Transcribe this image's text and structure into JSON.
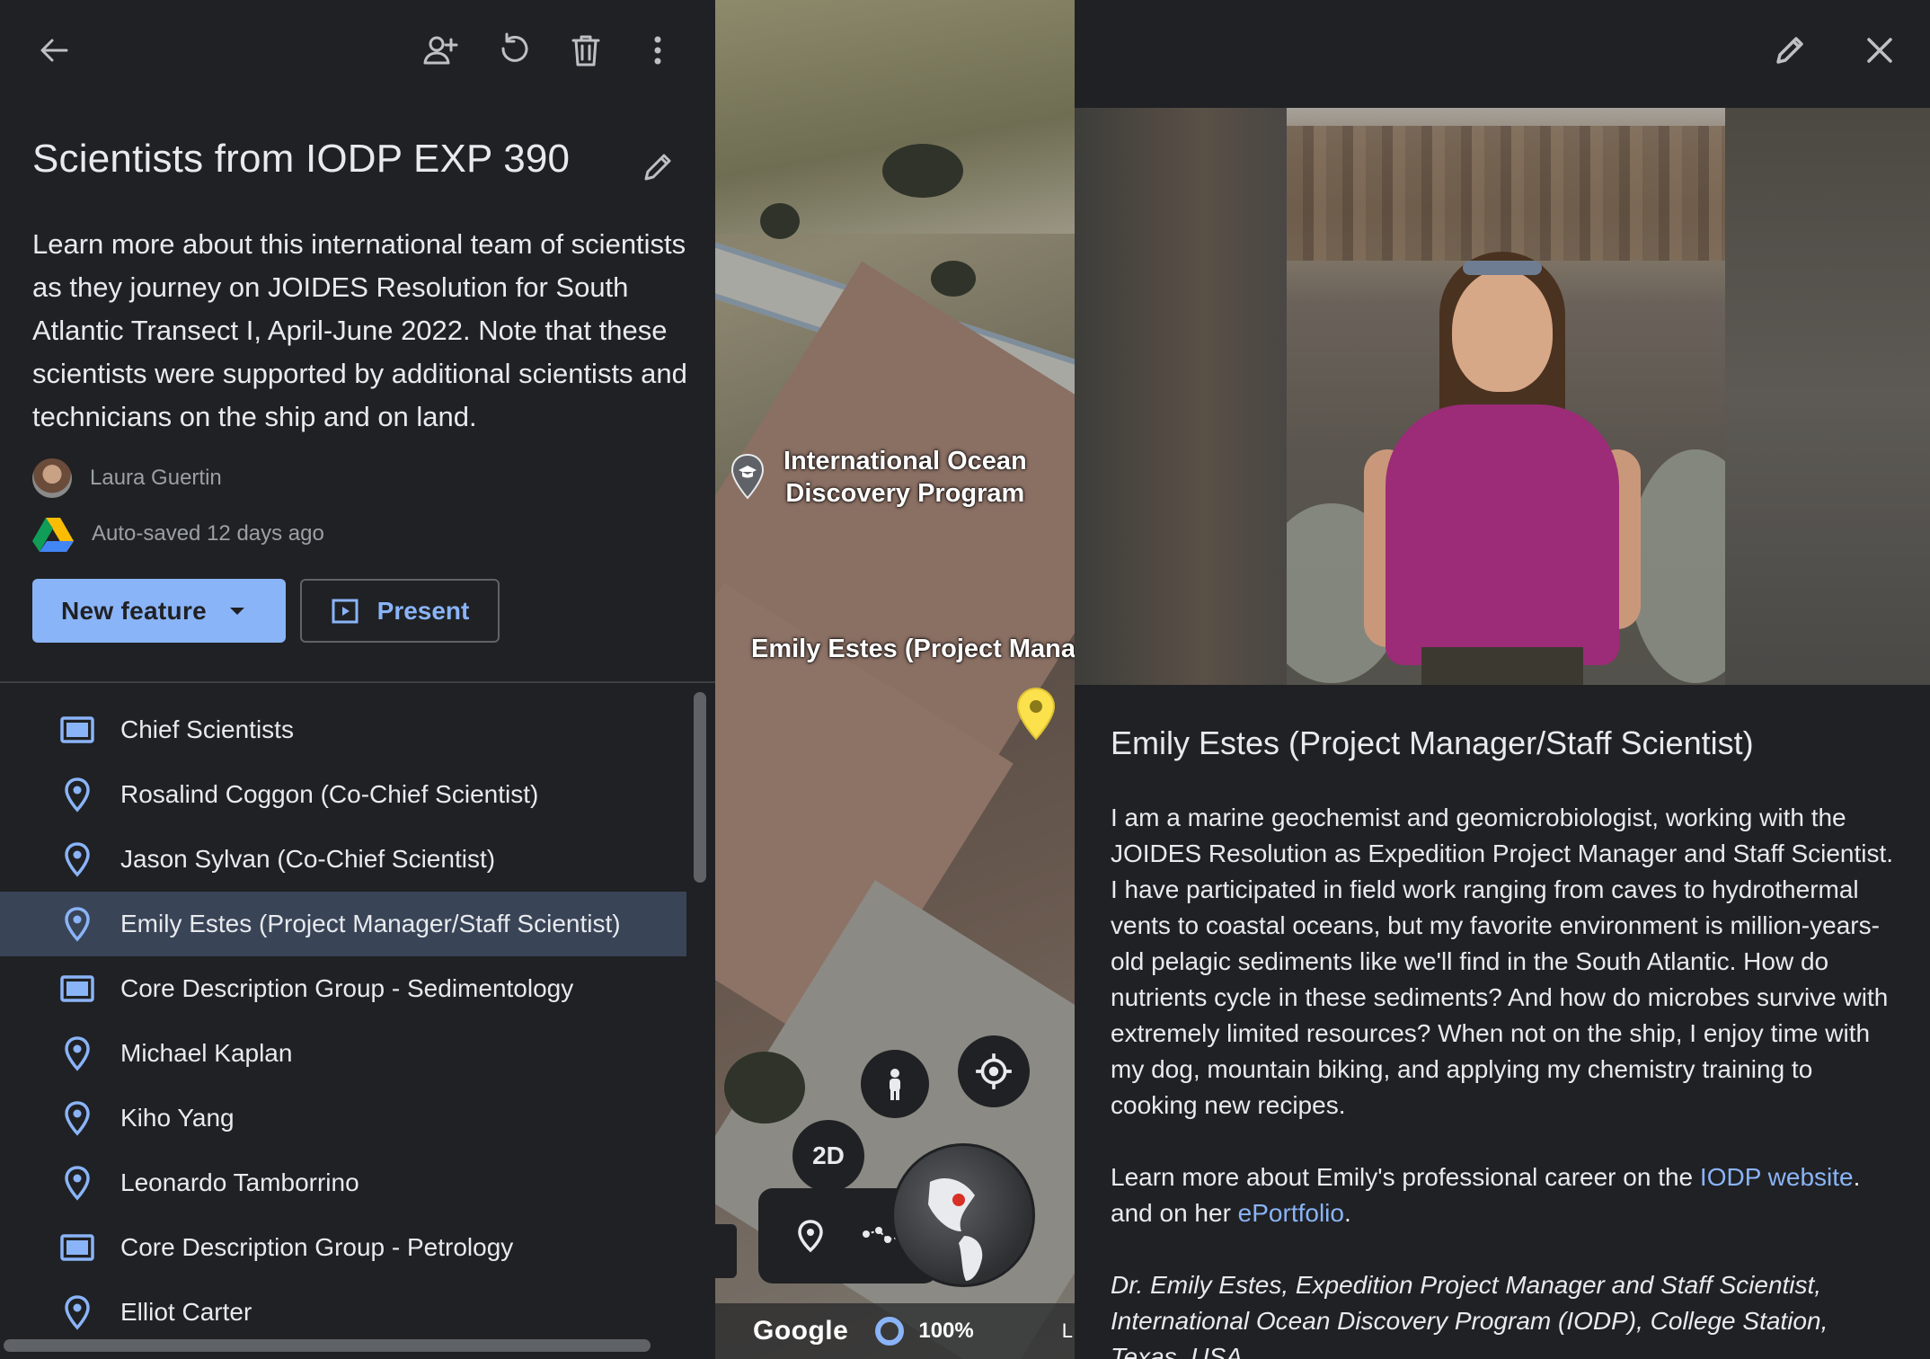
{
  "left_panel": {
    "project_title": "Scientists from IODP EXP 390",
    "description": "Learn more about this international team of scientists as they journey on JOIDES Resolution for South Atlantic Transect I, April-June 2022. Note that these scientists were supported by additional scientists and technicians on the ship and on land.",
    "author_name": "Laura Guertin",
    "save_status": "Auto-saved 12 days ago",
    "new_feature_label": "New feature",
    "present_label": "Present",
    "features": [
      {
        "label": "Chief Scientists",
        "icon": "folder-icon"
      },
      {
        "label": "Rosalind Coggon (Co-Chief Scientist)",
        "icon": "placemark-icon"
      },
      {
        "label": "Jason Sylvan (Co-Chief Scientist)",
        "icon": "placemark-icon"
      },
      {
        "label": "Emily Estes (Project Manager/Staff Scientist)",
        "icon": "placemark-icon",
        "selected": true
      },
      {
        "label": "Core Description Group - Sedimentology",
        "icon": "folder-icon"
      },
      {
        "label": "Michael Kaplan",
        "icon": "placemark-icon"
      },
      {
        "label": "Kiho Yang",
        "icon": "placemark-icon"
      },
      {
        "label": "Leonardo Tamborrino",
        "icon": "placemark-icon"
      },
      {
        "label": "Core Description Group - Petrology",
        "icon": "folder-icon"
      },
      {
        "label": "Elliot Carter",
        "icon": "placemark-icon"
      }
    ]
  },
  "map": {
    "place_label_line1": "International Ocean",
    "place_label_line2": "Discovery Program",
    "feature_label": "Emily Estes (Project Mana",
    "view_mode_button": "2D",
    "logo": "Google",
    "zoom_percent": "100%",
    "edge_letter": "L"
  },
  "right_panel": {
    "feature_title": "Emily Estes (Project Manager/Staff Scientist)",
    "body": "I am a marine geochemist and geomicrobiologist, working with the JOIDES Resolution as Expedition Project Manager and Staff Scientist. I have participated in field work ranging from caves to hydrothermal vents to coastal oceans, but my favorite environment is million-years-old pelagic sediments like we'll find in the South Atlantic. How do nutrients cycle in these sediments? And how do microbes survive with extremely limited resources? When not on the ship, I enjoy time with my dog, mountain biking, and applying my chemistry training to cooking new recipes.",
    "links_prefix": "Learn more about Emily's professional career on the ",
    "link1_text": "IODP website",
    "links_middle": ". and on her ",
    "link2_text": "ePortfolio",
    "links_suffix": ".",
    "signature": "Dr. Emily Estes, Expedition Project Manager and Staff Scientist, International Ocean Discovery Program (IODP), College Station, Texas, USA"
  },
  "colors": {
    "background": "#202124",
    "accent": "#8ab4f8",
    "selected_row": "#394457",
    "text_primary": "#e8eaed",
    "text_secondary": "#9aa0a6",
    "pin_yellow": "#fbe14c"
  }
}
